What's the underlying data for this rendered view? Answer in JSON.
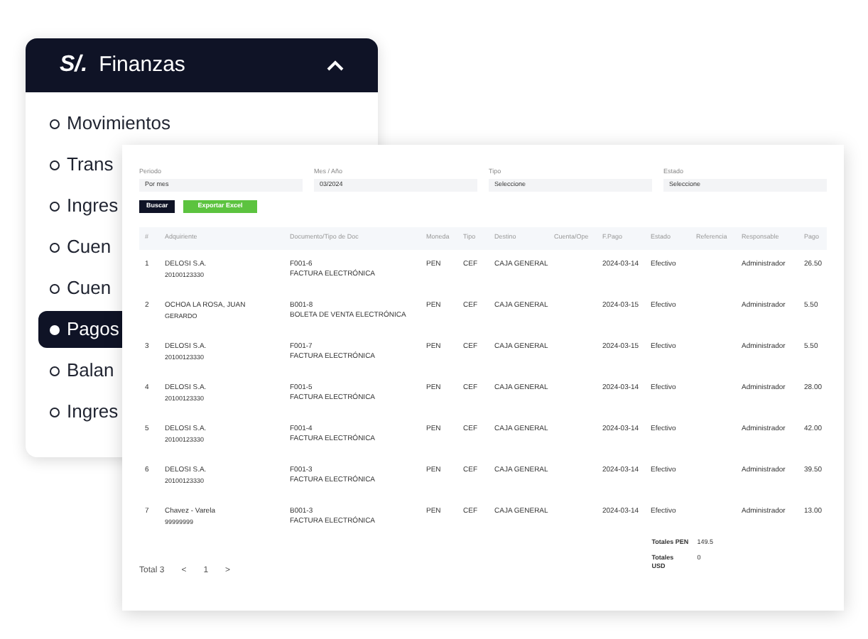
{
  "menu": {
    "currency": "S/.",
    "title": "Finanzas",
    "expanded": true,
    "items": [
      {
        "label": "Movimientos",
        "selected": false
      },
      {
        "label": "Trans",
        "selected": false
      },
      {
        "label": "Ingres",
        "selected": false
      },
      {
        "label": "Cuen",
        "selected": false
      },
      {
        "label": "Cuen",
        "selected": false
      },
      {
        "label": "Pagos",
        "selected": true
      },
      {
        "label": "Balan",
        "selected": false
      },
      {
        "label": "Ingres",
        "selected": false
      }
    ]
  },
  "filters": [
    {
      "label": "Periodo",
      "value": "Por mes"
    },
    {
      "label": "Mes / Año",
      "value": "03/2024"
    },
    {
      "label": "Tipo",
      "value": "Seleccione"
    },
    {
      "label": "Estado",
      "value": "Seleccione"
    }
  ],
  "buttons": {
    "search": "Buscar",
    "export": "Exportar Excel"
  },
  "table": {
    "columns": [
      "#",
      "Adquiriente",
      "Documento/Tipo de Doc",
      "Moneda",
      "Tipo",
      "Destino",
      "Cuenta/Ope",
      "F.Pago",
      "Estado",
      "Referencia",
      "Responsable",
      "Pago"
    ],
    "rows": [
      [
        "1",
        [
          "DELOSI S.A.",
          "20100123330"
        ],
        [
          "F001-6",
          "FACTURA ELECTRÓNICA"
        ],
        "PEN",
        "CEF",
        "CAJA GENERAL",
        "",
        "2024-03-14",
        "Efectivo",
        "",
        "Administrador",
        "26.50"
      ],
      [
        "2",
        [
          "OCHOA LA ROSA, JUAN",
          "GERARDO"
        ],
        [
          "B001-8",
          "BOLETA DE VENTA ELECTRÓNICA"
        ],
        "PEN",
        "CEF",
        "CAJA GENERAL",
        "",
        "2024-03-15",
        "Efectivo",
        "",
        "Administrador",
        "5.50"
      ],
      [
        "3",
        [
          "DELOSI S.A.",
          "20100123330"
        ],
        [
          "F001-7",
          "FACTURA ELECTRÓNICA"
        ],
        "PEN",
        "CEF",
        "CAJA GENERAL",
        "",
        "2024-03-15",
        "Efectivo",
        "",
        "Administrador",
        "5.50"
      ],
      [
        "4",
        [
          "DELOSI S.A.",
          "20100123330"
        ],
        [
          "F001-5",
          "FACTURA ELECTRÓNICA"
        ],
        "PEN",
        "CEF",
        "CAJA GENERAL",
        "",
        "2024-03-14",
        "Efectivo",
        "",
        "Administrador",
        "28.00"
      ],
      [
        "5",
        [
          "DELOSI S.A.",
          "20100123330"
        ],
        [
          "F001-4",
          "FACTURA ELECTRÓNICA"
        ],
        "PEN",
        "CEF",
        "CAJA GENERAL",
        "",
        "2024-03-14",
        "Efectivo",
        "",
        "Administrador",
        "42.00"
      ],
      [
        "6",
        [
          "DELOSI S.A.",
          "20100123330"
        ],
        [
          "F001-3",
          "FACTURA ELECTRÓNICA"
        ],
        "PEN",
        "CEF",
        "CAJA GENERAL",
        "",
        "2024-03-14",
        "Efectivo",
        "",
        "Administrador",
        "39.50"
      ],
      [
        "7",
        [
          "Chavez - Varela",
          "99999999"
        ],
        [
          "B001-3",
          "FACTURA ELECTRÓNICA"
        ],
        "PEN",
        "CEF",
        "CAJA GENERAL",
        "",
        "2024-03-14",
        "Efectivo",
        "",
        "Administrador",
        "13.00"
      ]
    ]
  },
  "totals": [
    {
      "label": "Totales PEN",
      "value": "149.5"
    },
    {
      "label": "Totales USD",
      "value": "0"
    }
  ],
  "pagination": {
    "total": "Total 3",
    "prev": "<",
    "page": "1",
    "next": ">"
  }
}
